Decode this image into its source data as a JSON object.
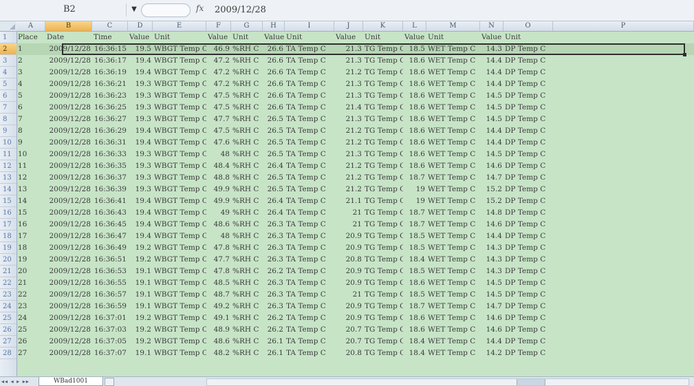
{
  "formula_bar": {
    "cell_ref": "B2",
    "fx": "fx",
    "value": "2009/12/28"
  },
  "columns": [
    "A",
    "B",
    "C",
    "D",
    "E",
    "F",
    "G",
    "H",
    "I",
    "J",
    "K",
    "L",
    "M",
    "N",
    "O",
    "P"
  ],
  "selected_column": "B",
  "selected_row": "2",
  "header_row": [
    "Place",
    "Date",
    "Time",
    "Value",
    "Unit",
    "Value",
    "Unit",
    "Value",
    "Unit",
    "Value",
    "Unit",
    "Value",
    "Unit",
    "Value",
    "Unit"
  ],
  "rows": [
    [
      "1",
      "2009/12/28",
      "16:36:15",
      "19.5",
      "WBGT Temp C",
      "46.9",
      "%RH C",
      "26.6",
      "TA Temp C",
      "21.3",
      "TG Temp C",
      "18.5",
      "WET Temp C",
      "14.3",
      "DP Temp C"
    ],
    [
      "2",
      "2009/12/28",
      "16:36:17",
      "19.4",
      "WBGT Temp C",
      "47.2",
      "%RH C",
      "26.6",
      "TA Temp C",
      "21.3",
      "TG Temp C",
      "18.6",
      "WET Temp C",
      "14.4",
      "DP Temp C"
    ],
    [
      "3",
      "2009/12/28",
      "16:36:19",
      "19.4",
      "WBGT Temp C",
      "47.2",
      "%RH C",
      "26.6",
      "TA Temp C",
      "21.2",
      "TG Temp C",
      "18.6",
      "WET Temp C",
      "14.4",
      "DP Temp C"
    ],
    [
      "4",
      "2009/12/28",
      "16:36:21",
      "19.3",
      "WBGT Temp C",
      "47.2",
      "%RH C",
      "26.6",
      "TA Temp C",
      "21.3",
      "TG Temp C",
      "18.6",
      "WET Temp C",
      "14.4",
      "DP Temp C"
    ],
    [
      "5",
      "2009/12/28",
      "16:36:23",
      "19.3",
      "WBGT Temp C",
      "47.5",
      "%RH C",
      "26.6",
      "TA Temp C",
      "21.3",
      "TG Temp C",
      "18.6",
      "WET Temp C",
      "14.5",
      "DP Temp C"
    ],
    [
      "6",
      "2009/12/28",
      "16:36:25",
      "19.3",
      "WBGT Temp C",
      "47.5",
      "%RH C",
      "26.6",
      "TA Temp C",
      "21.4",
      "TG Temp C",
      "18.6",
      "WET Temp C",
      "14.5",
      "DP Temp C"
    ],
    [
      "7",
      "2009/12/28",
      "16:36:27",
      "19.3",
      "WBGT Temp C",
      "47.7",
      "%RH C",
      "26.5",
      "TA Temp C",
      "21.3",
      "TG Temp C",
      "18.6",
      "WET Temp C",
      "14.5",
      "DP Temp C"
    ],
    [
      "8",
      "2009/12/28",
      "16:36:29",
      "19.4",
      "WBGT Temp C",
      "47.5",
      "%RH C",
      "26.5",
      "TA Temp C",
      "21.2",
      "TG Temp C",
      "18.6",
      "WET Temp C",
      "14.4",
      "DP Temp C"
    ],
    [
      "9",
      "2009/12/28",
      "16:36:31",
      "19.4",
      "WBGT Temp C",
      "47.6",
      "%RH C",
      "26.5",
      "TA Temp C",
      "21.2",
      "TG Temp C",
      "18.6",
      "WET Temp C",
      "14.4",
      "DP Temp C"
    ],
    [
      "10",
      "2009/12/28",
      "16:36:33",
      "19.3",
      "WBGT Temp C",
      "48",
      "%RH C",
      "26.5",
      "TA Temp C",
      "21.3",
      "TG Temp C",
      "18.6",
      "WET Temp C",
      "14.5",
      "DP Temp C"
    ],
    [
      "11",
      "2009/12/28",
      "16:36:35",
      "19.3",
      "WBGT Temp C",
      "48.4",
      "%RH C",
      "26.4",
      "TA Temp C",
      "21.2",
      "TG Temp C",
      "18.6",
      "WET Temp C",
      "14.6",
      "DP Temp C"
    ],
    [
      "12",
      "2009/12/28",
      "16:36:37",
      "19.3",
      "WBGT Temp C",
      "48.8",
      "%RH C",
      "26.5",
      "TA Temp C",
      "21.2",
      "TG Temp C",
      "18.7",
      "WET Temp C",
      "14.7",
      "DP Temp C"
    ],
    [
      "13",
      "2009/12/28",
      "16:36:39",
      "19.3",
      "WBGT Temp C",
      "49.9",
      "%RH C",
      "26.5",
      "TA Temp C",
      "21.2",
      "TG Temp C",
      "19",
      "WET Temp C",
      "15.2",
      "DP Temp C"
    ],
    [
      "14",
      "2009/12/28",
      "16:36:41",
      "19.4",
      "WBGT Temp C",
      "49.9",
      "%RH C",
      "26.4",
      "TA Temp C",
      "21.1",
      "TG Temp C",
      "19",
      "WET Temp C",
      "15.2",
      "DP Temp C"
    ],
    [
      "15",
      "2009/12/28",
      "16:36:43",
      "19.4",
      "WBGT Temp C",
      "49",
      "%RH C",
      "26.4",
      "TA Temp C",
      "21",
      "TG Temp C",
      "18.7",
      "WET Temp C",
      "14.8",
      "DP Temp C"
    ],
    [
      "16",
      "2009/12/28",
      "16:36:45",
      "19.4",
      "WBGT Temp C",
      "48.6",
      "%RH C",
      "26.3",
      "TA Temp C",
      "21",
      "TG Temp C",
      "18.7",
      "WET Temp C",
      "14.6",
      "DP Temp C"
    ],
    [
      "17",
      "2009/12/28",
      "16:36:47",
      "19.4",
      "WBGT Temp C",
      "48",
      "%RH C",
      "26.3",
      "TA Temp C",
      "20.9",
      "TG Temp C",
      "18.5",
      "WET Temp C",
      "14.4",
      "DP Temp C"
    ],
    [
      "18",
      "2009/12/28",
      "16:36:49",
      "19.2",
      "WBGT Temp C",
      "47.8",
      "%RH C",
      "26.3",
      "TA Temp C",
      "20.9",
      "TG Temp C",
      "18.5",
      "WET Temp C",
      "14.3",
      "DP Temp C"
    ],
    [
      "19",
      "2009/12/28",
      "16:36:51",
      "19.2",
      "WBGT Temp C",
      "47.7",
      "%RH C",
      "26.3",
      "TA Temp C",
      "20.8",
      "TG Temp C",
      "18.4",
      "WET Temp C",
      "14.3",
      "DP Temp C"
    ],
    [
      "20",
      "2009/12/28",
      "16:36:53",
      "19.1",
      "WBGT Temp C",
      "47.8",
      "%RH C",
      "26.2",
      "TA Temp C",
      "20.9",
      "TG Temp C",
      "18.5",
      "WET Temp C",
      "14.3",
      "DP Temp C"
    ],
    [
      "21",
      "2009/12/28",
      "16:36:55",
      "19.1",
      "WBGT Temp C",
      "48.5",
      "%RH C",
      "26.3",
      "TA Temp C",
      "20.9",
      "TG Temp C",
      "18.6",
      "WET Temp C",
      "14.5",
      "DP Temp C"
    ],
    [
      "22",
      "2009/12/28",
      "16:36:57",
      "19.1",
      "WBGT Temp C",
      "48.7",
      "%RH C",
      "26.3",
      "TA Temp C",
      "21",
      "TG Temp C",
      "18.5",
      "WET Temp C",
      "14.5",
      "DP Temp C"
    ],
    [
      "23",
      "2009/12/28",
      "16:36:59",
      "19.1",
      "WBGT Temp C",
      "49.2",
      "%RH C",
      "26.3",
      "TA Temp C",
      "20.9",
      "TG Temp C",
      "18.7",
      "WET Temp C",
      "14.7",
      "DP Temp C"
    ],
    [
      "24",
      "2009/12/28",
      "16:37:01",
      "19.2",
      "WBGT Temp C",
      "49.1",
      "%RH C",
      "26.2",
      "TA Temp C",
      "20.9",
      "TG Temp C",
      "18.6",
      "WET Temp C",
      "14.6",
      "DP Temp C"
    ],
    [
      "25",
      "2009/12/28",
      "16:37:03",
      "19.2",
      "WBGT Temp C",
      "48.9",
      "%RH C",
      "26.2",
      "TA Temp C",
      "20.7",
      "TG Temp C",
      "18.6",
      "WET Temp C",
      "14.6",
      "DP Temp C"
    ],
    [
      "26",
      "2009/12/28",
      "16:37:05",
      "19.2",
      "WBGT Temp C",
      "48.6",
      "%RH C",
      "26.1",
      "TA Temp C",
      "20.7",
      "TG Temp C",
      "18.4",
      "WET Temp C",
      "14.4",
      "DP Temp C"
    ],
    [
      "27",
      "2009/12/28",
      "16:37:07",
      "19.1",
      "WBGT Temp C",
      "48.2",
      "%RH C",
      "26.1",
      "TA Temp C",
      "20.8",
      "TG Temp C",
      "18.4",
      "WET Temp C",
      "14.2",
      "DP Temp C"
    ]
  ],
  "sheet": {
    "nav": "◂◂ ◂ ▸ ▸▸",
    "tab_label": "WBad1001"
  },
  "colors": {
    "grid_bg": "#c7e4c7",
    "selected_header": "#efb24f"
  }
}
